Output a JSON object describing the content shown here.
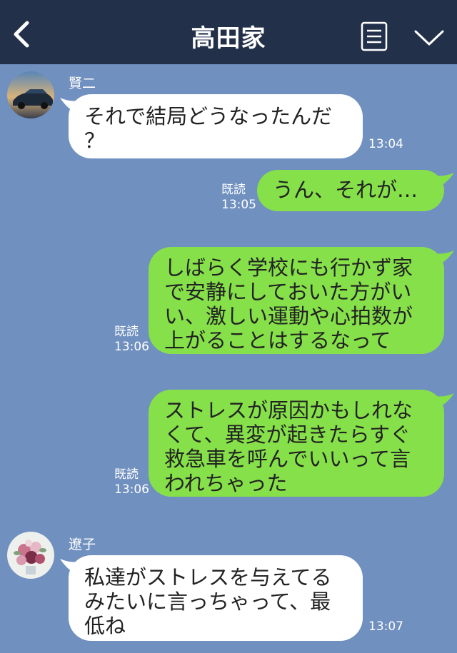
{
  "header": {
    "title": "高田家"
  },
  "messages": [
    {
      "sender": "賢二",
      "text": "それで結局どうなったんだ\n？",
      "time": "13:04"
    },
    {
      "read": "既読",
      "time": "13:05",
      "text": "うん、それが…"
    },
    {
      "read": "既読",
      "time": "13:06",
      "text": "しばらく学校にも行かず家\nで安静にしておいた方がい\nい、激しい運動や心拍数が\n上がることはするなって"
    },
    {
      "read": "既読",
      "time": "13:06",
      "text": "ストレスが原因かもしれな\nくて、異変が起きたらすぐ\n救急車を呼んでいいって言\nわれちゃった"
    },
    {
      "sender": "遼子",
      "text": "私達がストレスを与えてる\nみたいに言っちゃって、最\n低ね",
      "time": "13:07"
    }
  ],
  "colors": {
    "header": "#22304a",
    "background": "#7090c0",
    "outgoing": "#86e04a",
    "incoming": "#ffffff"
  }
}
